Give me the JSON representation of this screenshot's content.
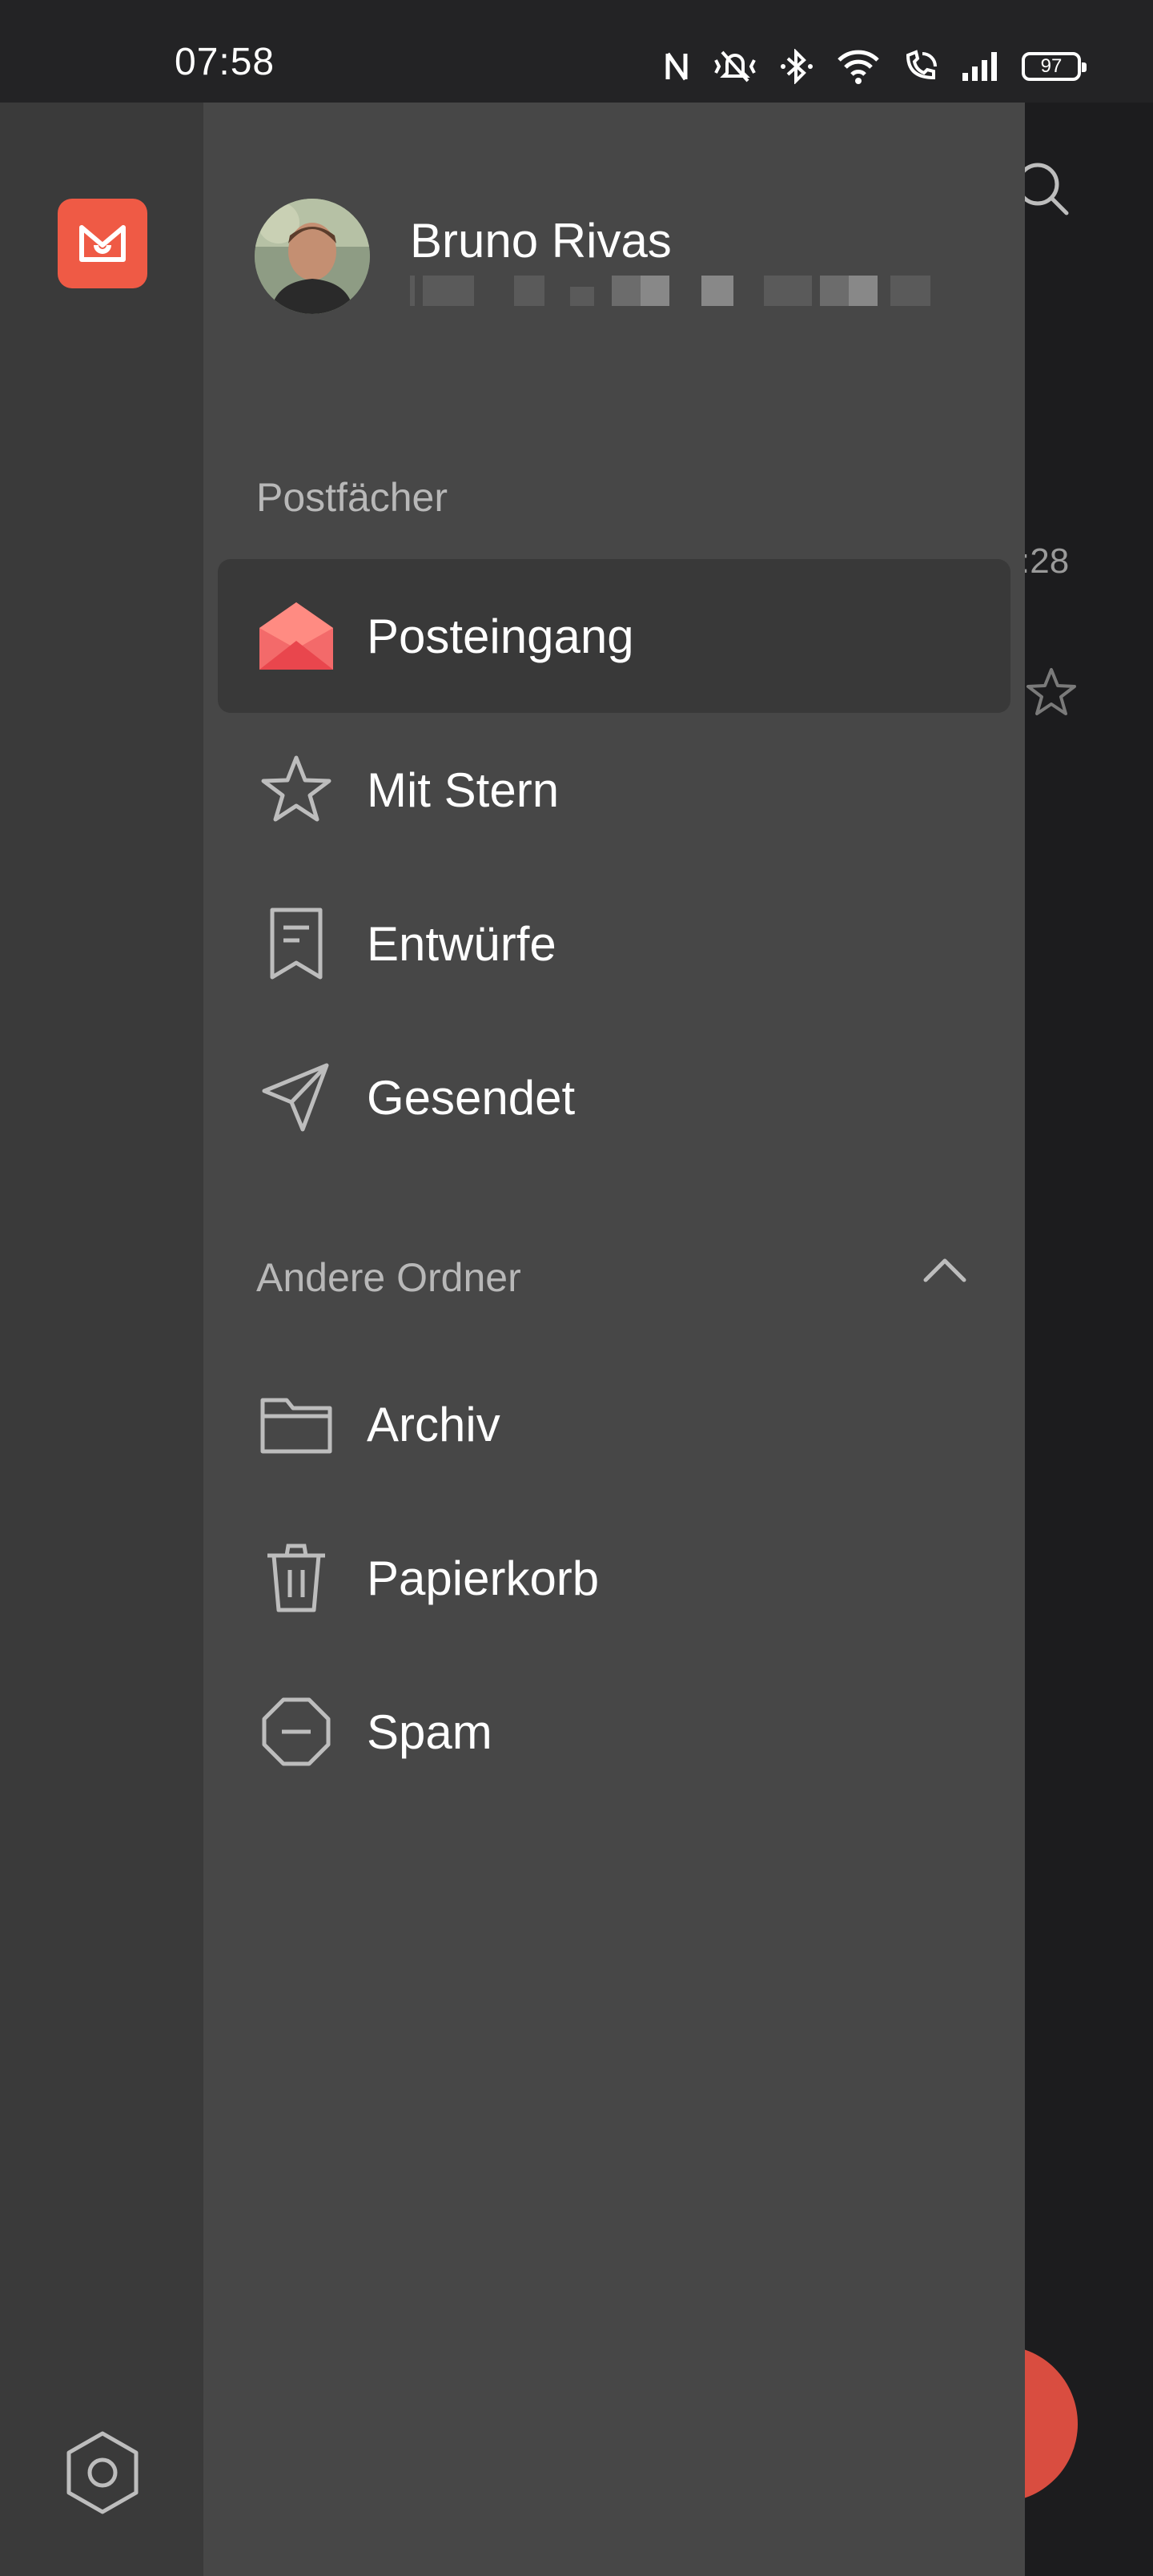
{
  "status_bar": {
    "time": "07:58",
    "battery": "97",
    "icons": [
      "nfc-icon",
      "vibrate-icon",
      "bluetooth-icon",
      "wifi-icon",
      "wifi-call-icon",
      "signal-icon",
      "battery-icon"
    ]
  },
  "account": {
    "name": "Bruno Rivas"
  },
  "mailboxes": {
    "title": "Postfächer",
    "items": [
      {
        "label": "Posteingang",
        "icon": "inbox-icon",
        "active": true
      },
      {
        "label": "Mit Stern",
        "icon": "star-icon"
      },
      {
        "label": "Entwürfe",
        "icon": "draft-icon"
      },
      {
        "label": "Gesendet",
        "icon": "sent-icon"
      }
    ]
  },
  "other_folders": {
    "title": "Andere Ordner",
    "expanded": true,
    "items": [
      {
        "label": "Archiv",
        "icon": "folder-icon"
      },
      {
        "label": "Papierkorb",
        "icon": "trash-icon"
      },
      {
        "label": "Spam",
        "icon": "spam-icon"
      }
    ]
  },
  "background": {
    "time_fragment": ":28"
  },
  "colors": {
    "accent": "#ef5a45",
    "drawer": "#474747",
    "rail": "#3a3a3a",
    "active_item": "#393939"
  }
}
